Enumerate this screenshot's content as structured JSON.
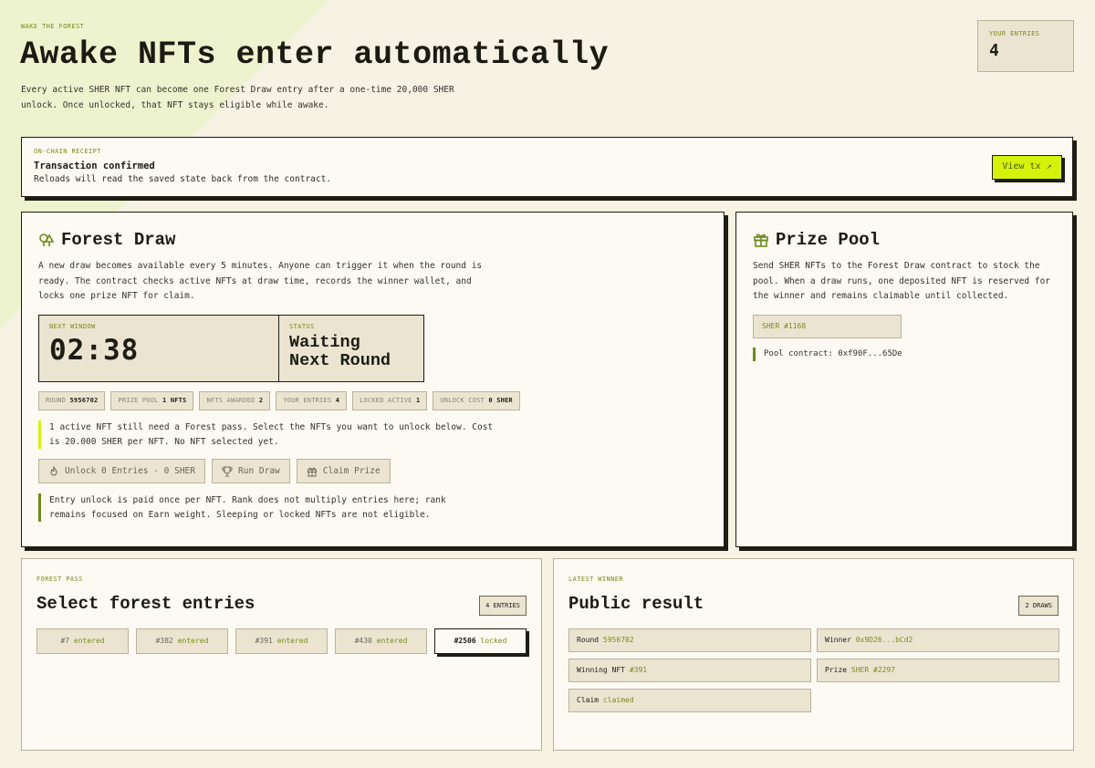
{
  "header": {
    "eyebrow": "WAKE THE FOREST",
    "title": "Awake NFTs enter automatically",
    "description": "Every active SHER NFT can become one Forest Draw entry after a one-time 20,000 SHER unlock. Once unlocked, that NFT stays eligible while awake.",
    "your_entries_label": "YOUR ENTRIES",
    "your_entries_value": "4"
  },
  "receipt": {
    "eyebrow": "ON-CHAIN RECEIPT",
    "title": "Transaction confirmed",
    "subtitle": "Reloads will read the saved state back from the contract.",
    "view_tx_label": "View tx ↗"
  },
  "forest_draw": {
    "title": "Forest Draw",
    "icon": "trees-icon",
    "description": "A new draw becomes available every 5 minutes. Anyone can trigger it when the round is ready. The contract checks active NFTs at draw time, records the winner wallet, and locks one prize NFT for claim.",
    "next_window_label": "NEXT WINDOW",
    "next_window_value": "02:38",
    "status_label": "STATUS",
    "status_line1": "Waiting",
    "status_line2": "Next Round",
    "stats": [
      {
        "label": "ROUND",
        "value": "5956702"
      },
      {
        "label": "PRIZE POOL",
        "value": "1 NFTs"
      },
      {
        "label": "NFTS AWARDED",
        "value": "2"
      },
      {
        "label": "YOUR ENTRIES",
        "value": "4"
      },
      {
        "label": "LOCKED ACTIVE",
        "value": "1"
      },
      {
        "label": "UNLOCK COST",
        "value": "0 SHER"
      }
    ],
    "notice": "1 active NFT still need a Forest pass. Select the NFTs you want to unlock below. Cost is 20.000 SHER per NFT. No NFT selected yet.",
    "buttons": {
      "unlock": "Unlock 0 Entries - 0 SHER",
      "run_draw": "Run Draw",
      "claim_prize": "Claim Prize"
    },
    "footnote": "Entry unlock is paid once per NFT. Rank does not multiply entries here; rank remains focused on Earn weight. Sleeping or locked NFTs are not eligible."
  },
  "prize_pool": {
    "title": "Prize Pool",
    "icon": "gift-icon",
    "description": "Send SHER NFTs to the Forest Draw contract to stock the pool. When a draw runs, one deposited NFT is reserved for the winner and remains claimable until collected.",
    "chip": "SHER #1168",
    "contract": "Pool contract: 0xf90F...65De"
  },
  "forest_pass": {
    "eyebrow": "FOREST PASS",
    "title": "Select forest entries",
    "badge": "4 ENTRIES",
    "nfts": [
      {
        "id": "#7",
        "state": "entered"
      },
      {
        "id": "#382",
        "state": "entered"
      },
      {
        "id": "#391",
        "state": "entered"
      },
      {
        "id": "#430",
        "state": "entered"
      },
      {
        "id": "#2506",
        "state": "locked"
      }
    ]
  },
  "latest_winner": {
    "eyebrow": "LATEST WINNER",
    "title": "Public result",
    "badge": "2 DRAWS",
    "round_label": "Round",
    "round_value": "5956702",
    "winner_label": "Winner",
    "winner_value": "0x9D26...bCd2",
    "winning_nft_label": "Winning NFT",
    "winning_nft_value": "#391",
    "prize_label": "Prize",
    "prize_value": "SHER #2297",
    "claim_label": "Claim",
    "claim_value": "claimed"
  },
  "colors": {
    "background": "#f6f2e4",
    "card": "#fcfaf2",
    "accent_lime": "#d4f20a",
    "accent_olive": "#7a8a1e",
    "ink": "#1d1d14"
  }
}
